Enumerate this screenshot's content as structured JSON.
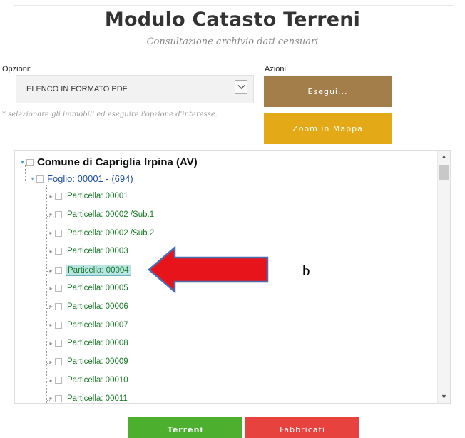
{
  "header": {
    "title": "Modulo Catasto Terreni",
    "subtitle": "Consultazione archivio dati censuari"
  },
  "options": {
    "label": "Opzioni:",
    "selected": "ELENCO IN FORMATO PDF",
    "hint": "* selezionare gli immobili ed eseguire l'opzione d'interesse."
  },
  "actions": {
    "label": "Azioni:",
    "esegui": "Esegui...",
    "zoom": "Zoom in Mappa"
  },
  "tree": {
    "root": "Comune di Capriglia Irpina (AV)",
    "foglio": "Foglio: 00001 - (694)",
    "particelle": [
      "Particella: 00001",
      "Particella: 00002 /Sub.1",
      "Particella: 00002 /Sub.2",
      "Particella: 00003",
      "Particella: 00004",
      "Particella: 00005",
      "Particella: 00006",
      "Particella: 00007",
      "Particella: 00008",
      "Particella: 00009",
      "Particella: 00010",
      "Particella: 00011"
    ],
    "selected_index": 4
  },
  "annotation": {
    "marker": "b",
    "arrow_color": "#e8141b"
  },
  "footer": {
    "terreni": "Terreni",
    "fabbricati": "Fabbricati"
  },
  "colors": {
    "esegui": "#a47e4a",
    "zoom": "#e3a917",
    "terreni": "#4caf2e",
    "fabbricati": "#e8423f"
  }
}
